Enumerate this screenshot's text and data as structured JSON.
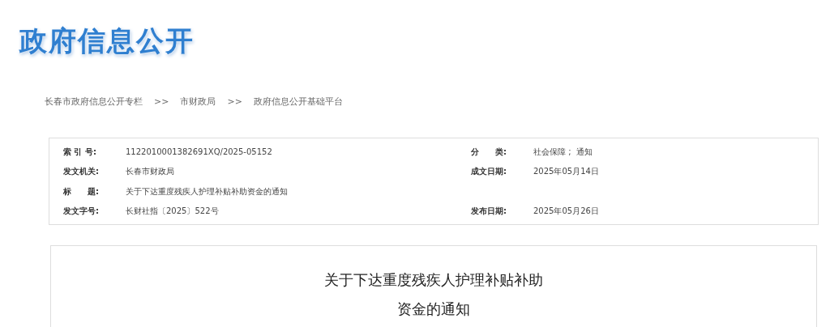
{
  "logo": {
    "text": "政府信息公开"
  },
  "breadcrumb": [
    {
      "label": "长春市政府信息公开专栏"
    },
    {
      "label": "市财政局"
    },
    {
      "label": "政府信息公开基础平台"
    }
  ],
  "breadcrumb_separator": ">>",
  "info_rows": [
    {
      "left": {
        "label": "索 引 号:",
        "value": "1122010001382691XQ/2025-05152"
      },
      "right": {
        "label": "分　　类:",
        "value": "社会保障 ;  通知"
      }
    },
    {
      "left": {
        "label": "发文机关:",
        "value": "长春市财政局"
      },
      "right": {
        "label": "成文日期:",
        "value": "2025年05月14日"
      }
    },
    {
      "left": {
        "label": "标　　题:",
        "value": "关于下达重度残疾人护理补贴补助资金的通知"
      }
    },
    {
      "left": {
        "label": "发文字号:",
        "value": "长财社指〔2025〕522号"
      },
      "right": {
        "label": "发布日期:",
        "value": "2025年05月26日"
      }
    }
  ],
  "document": {
    "title_lines": [
      "关于下达重度残疾人护理补贴补助",
      "资金的通知"
    ]
  }
}
